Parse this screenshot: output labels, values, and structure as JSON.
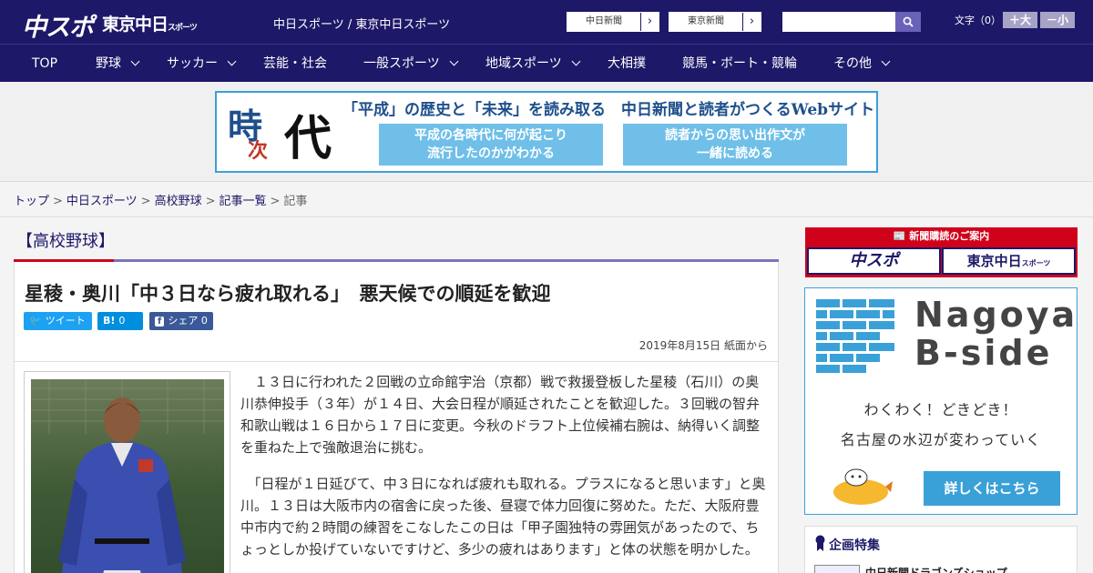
{
  "header": {
    "logo_main": "中スポ",
    "logo_sub": "東京中日",
    "logo_sub_small": "スポーツ",
    "site_title": "中日スポーツ / 東京中日スポーツ",
    "paper_links": [
      {
        "label": "中日新聞",
        "arrow": "›"
      },
      {
        "label": "東京新聞",
        "arrow": "›"
      }
    ],
    "search_placeholder": "",
    "font_size_label": "文字（0）",
    "font_plus": "＋大",
    "font_minus": "－小"
  },
  "nav": {
    "items": [
      {
        "label": "TOP",
        "dropdown": false
      },
      {
        "label": "野球",
        "dropdown": true
      },
      {
        "label": "サッカー",
        "dropdown": true
      },
      {
        "label": "芸能・社会",
        "dropdown": false
      },
      {
        "label": "一般スポーツ",
        "dropdown": true
      },
      {
        "label": "地域スポーツ",
        "dropdown": true
      },
      {
        "label": "大相撲",
        "dropdown": false
      },
      {
        "label": "競馬・ボート・競輪",
        "dropdown": false
      },
      {
        "label": "その他",
        "dropdown": true
      }
    ]
  },
  "banner": {
    "emblem_1": "時",
    "emblem_2": "次",
    "emblem_3": "代",
    "headline": "「平成」の歴史と「未来」を読み取る　中日新聞と読者がつくるWebサイト",
    "box_left_1": "平成の各時代に何が起こり",
    "box_left_2": "流行したのかがわかる",
    "box_right_1": "読者からの思い出作文が",
    "box_right_2": "一緒に読める"
  },
  "breadcrumb": {
    "items": [
      "トップ",
      "中日スポーツ",
      "高校野球",
      "記事一覧"
    ],
    "current": "記事",
    "separator": ">"
  },
  "article": {
    "category": "【高校野球】",
    "title": "星稜・奥川「中３日なら疲れ取れる」　悪天候での順延を歓迎",
    "share": {
      "tweet": "ツイート",
      "hatena_icon": "B!",
      "hatena_count": "0",
      "fb_label": "シェア",
      "fb_count": "0"
    },
    "date": "2019年8月15日 紙面から",
    "paragraph_1": "　１３日に行われた２回戦の立命館宇治（京都）戦で救援登板した星稜（石川）の奥川恭伸投手（３年）が１４日、大会日程が順延されたことを歓迎した。３回戦の智弁和歌山戦は１６日から１７日に変更。今秋のドラフト上位候補右腕は、納得いく調整を重ねた上で強敵退治に挑む。",
    "paragraph_2": "　「日程が１日延びて、中３日になれば疲れも取れる。プラスになると思います」と奥川。１３日は大阪市内の宿舎に戻った後、昼寝で体力回復に努めた。ただ、大阪府豊中市内で約２時間の練習をこなしたこの日は「甲子園独特の雰囲気があったので、ちょっとしか投げていないですけど、多少の疲れはあります」と体の状態を明かした。"
  },
  "sidebar": {
    "subscription_head": "新聞購読のご案内",
    "sub_logo_1": "中スポ",
    "sub_logo_2": "東京中日",
    "sub_logo_2_small": "スポーツ",
    "ad_title_1": "Nagoya",
    "ad_title_2": "B-side",
    "ad_copy_1": "わくわく！どきどき！",
    "ad_copy_2": "名古屋の水辺が変わっていく",
    "ad_button": "詳しくはこちら",
    "feature_title": "企画特集",
    "feature_item": "中日新聞ドラゴンズショップ"
  },
  "colors": {
    "header_navy": "#1e1868",
    "accent_red": "#d0021b",
    "accent_blue": "#3aa0d8",
    "twitter": "#1da1f2",
    "hatena": "#008fde",
    "facebook": "#3b5998"
  }
}
